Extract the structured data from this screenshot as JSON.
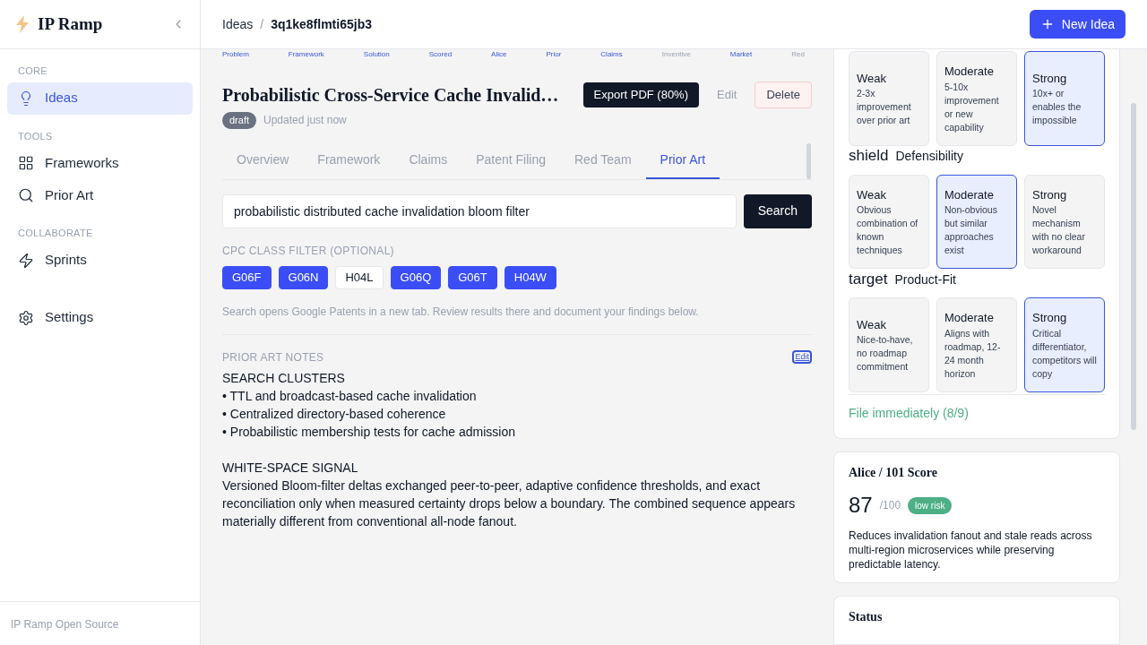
{
  "sidebar": {
    "brand": "IP Ramp",
    "sections": [
      {
        "title": "CORE",
        "items": [
          {
            "label": "Ideas",
            "kind": "bulb",
            "selected": true
          }
        ]
      },
      {
        "title": "TOOLS",
        "items": [
          {
            "label": "Frameworks",
            "kind": "grid",
            "selected": false
          },
          {
            "label": "Prior Art",
            "kind": "search",
            "selected": false
          }
        ]
      },
      {
        "title": "COLLABORATE",
        "items": [
          {
            "label": "Sprints",
            "kind": "bolt",
            "selected": false
          }
        ]
      },
      {
        "items": [
          {
            "label": "Settings",
            "kind": "gear",
            "selected": false
          }
        ]
      }
    ],
    "footer": "IP Ramp Open Source"
  },
  "header": {
    "breadcrumb": [
      "Ideas",
      "3q1ke8flmti65jb3"
    ],
    "separator": "/",
    "new_button": "New Idea"
  },
  "steps": [
    {
      "label": "Problem",
      "done": true
    },
    {
      "label": "Framework",
      "done": true
    },
    {
      "label": "Solution",
      "done": true
    },
    {
      "label": "Scored",
      "done": true
    },
    {
      "label": "Alice",
      "done": true
    },
    {
      "label": "Prior",
      "done": true
    },
    {
      "label": "Claims",
      "done": true
    },
    {
      "label": "Inventive",
      "done": false
    },
    {
      "label": "Market",
      "done": true
    },
    {
      "label": "Red",
      "done": false
    }
  ],
  "idea": {
    "title": "Probabilistic Cross-Service Cache Invalid…",
    "status": "draft",
    "updated": "Updated just now",
    "export_button": "Export PDF (80%)",
    "edit_button": "Edit",
    "delete_button": "Delete"
  },
  "tabs": [
    {
      "label": "Overview",
      "selected": false
    },
    {
      "label": "Framework",
      "selected": false
    },
    {
      "label": "Claims",
      "selected": false
    },
    {
      "label": "Patent Filing",
      "selected": false
    },
    {
      "label": "Red Team",
      "selected": false
    },
    {
      "label": "Prior Art",
      "selected": true
    }
  ],
  "search": {
    "value": "probabilistic distributed cache invalidation bloom filter",
    "button": "Search"
  },
  "cpc": {
    "label": "CPC CLASS FILTER (OPTIONAL)",
    "classes": [
      {
        "code": "G06F",
        "selected": true
      },
      {
        "code": "G06N",
        "selected": true
      },
      {
        "code": "H04L",
        "selected": false
      },
      {
        "code": "G06Q",
        "selected": true
      },
      {
        "code": "G06T",
        "selected": true
      },
      {
        "code": "H04W",
        "selected": true
      }
    ],
    "hint": "Search opens Google Patents in a new tab. Review results there and document your findings below."
  },
  "notes": {
    "label": "PRIOR ART NOTES",
    "edit": "Edit",
    "blocks": [
      [
        "SEARCH CLUSTERS",
        "• TTL and broadcast-based cache invalidation",
        "• Centralized directory-based coherence",
        "• Probabilistic membership tests for cache admission"
      ],
      [
        "WHITE-SPACE SIGNAL",
        "Versioned Bloom-filter deltas exchanged peer-to-peer, adaptive confidence thresholds, and exact reconciliation only when measured certainty drops below a boundary. The combined sequence appears materially different from conventional all-node fanout."
      ]
    ]
  },
  "criteria": [
    {
      "options": [
        {
          "level": "Weak",
          "text": "2-3x improvement over prior art",
          "selected": false
        },
        {
          "level": "Moderate",
          "text": "5-10x improvement or new capability",
          "selected": false
        },
        {
          "level": "Strong",
          "text": "10x+ or enables the impossible",
          "selected": true
        }
      ]
    },
    {
      "icon_word": "shield",
      "title": "Defensibility",
      "options": [
        {
          "level": "Weak",
          "text": "Obvious combination of known techniques",
          "selected": false
        },
        {
          "level": "Moderate",
          "text": "Non-obvious but similar approaches exist",
          "selected": true
        },
        {
          "level": "Strong",
          "text": "Novel mechanism with no clear workaround",
          "selected": false
        }
      ]
    },
    {
      "icon_word": "target",
      "title": "Product-Fit",
      "options": [
        {
          "level": "Weak",
          "text": "Nice-to-have, no roadmap commitment",
          "selected": false
        },
        {
          "level": "Moderate",
          "text": "Aligns with roadmap, 12-24 month horizon",
          "selected": false
        },
        {
          "level": "Strong",
          "text": "Critical differentiator, competitors will copy",
          "selected": true
        }
      ]
    }
  ],
  "verdict": "File immediately (8/9)",
  "alice": {
    "title": "Alice / 101 Score",
    "score": "87",
    "max": "/100",
    "risk": "low risk",
    "summary": "Reduces invalidation fanout and stale reads across multi-region microservices while preserving predictable latency."
  },
  "status": {
    "title": "Status"
  }
}
